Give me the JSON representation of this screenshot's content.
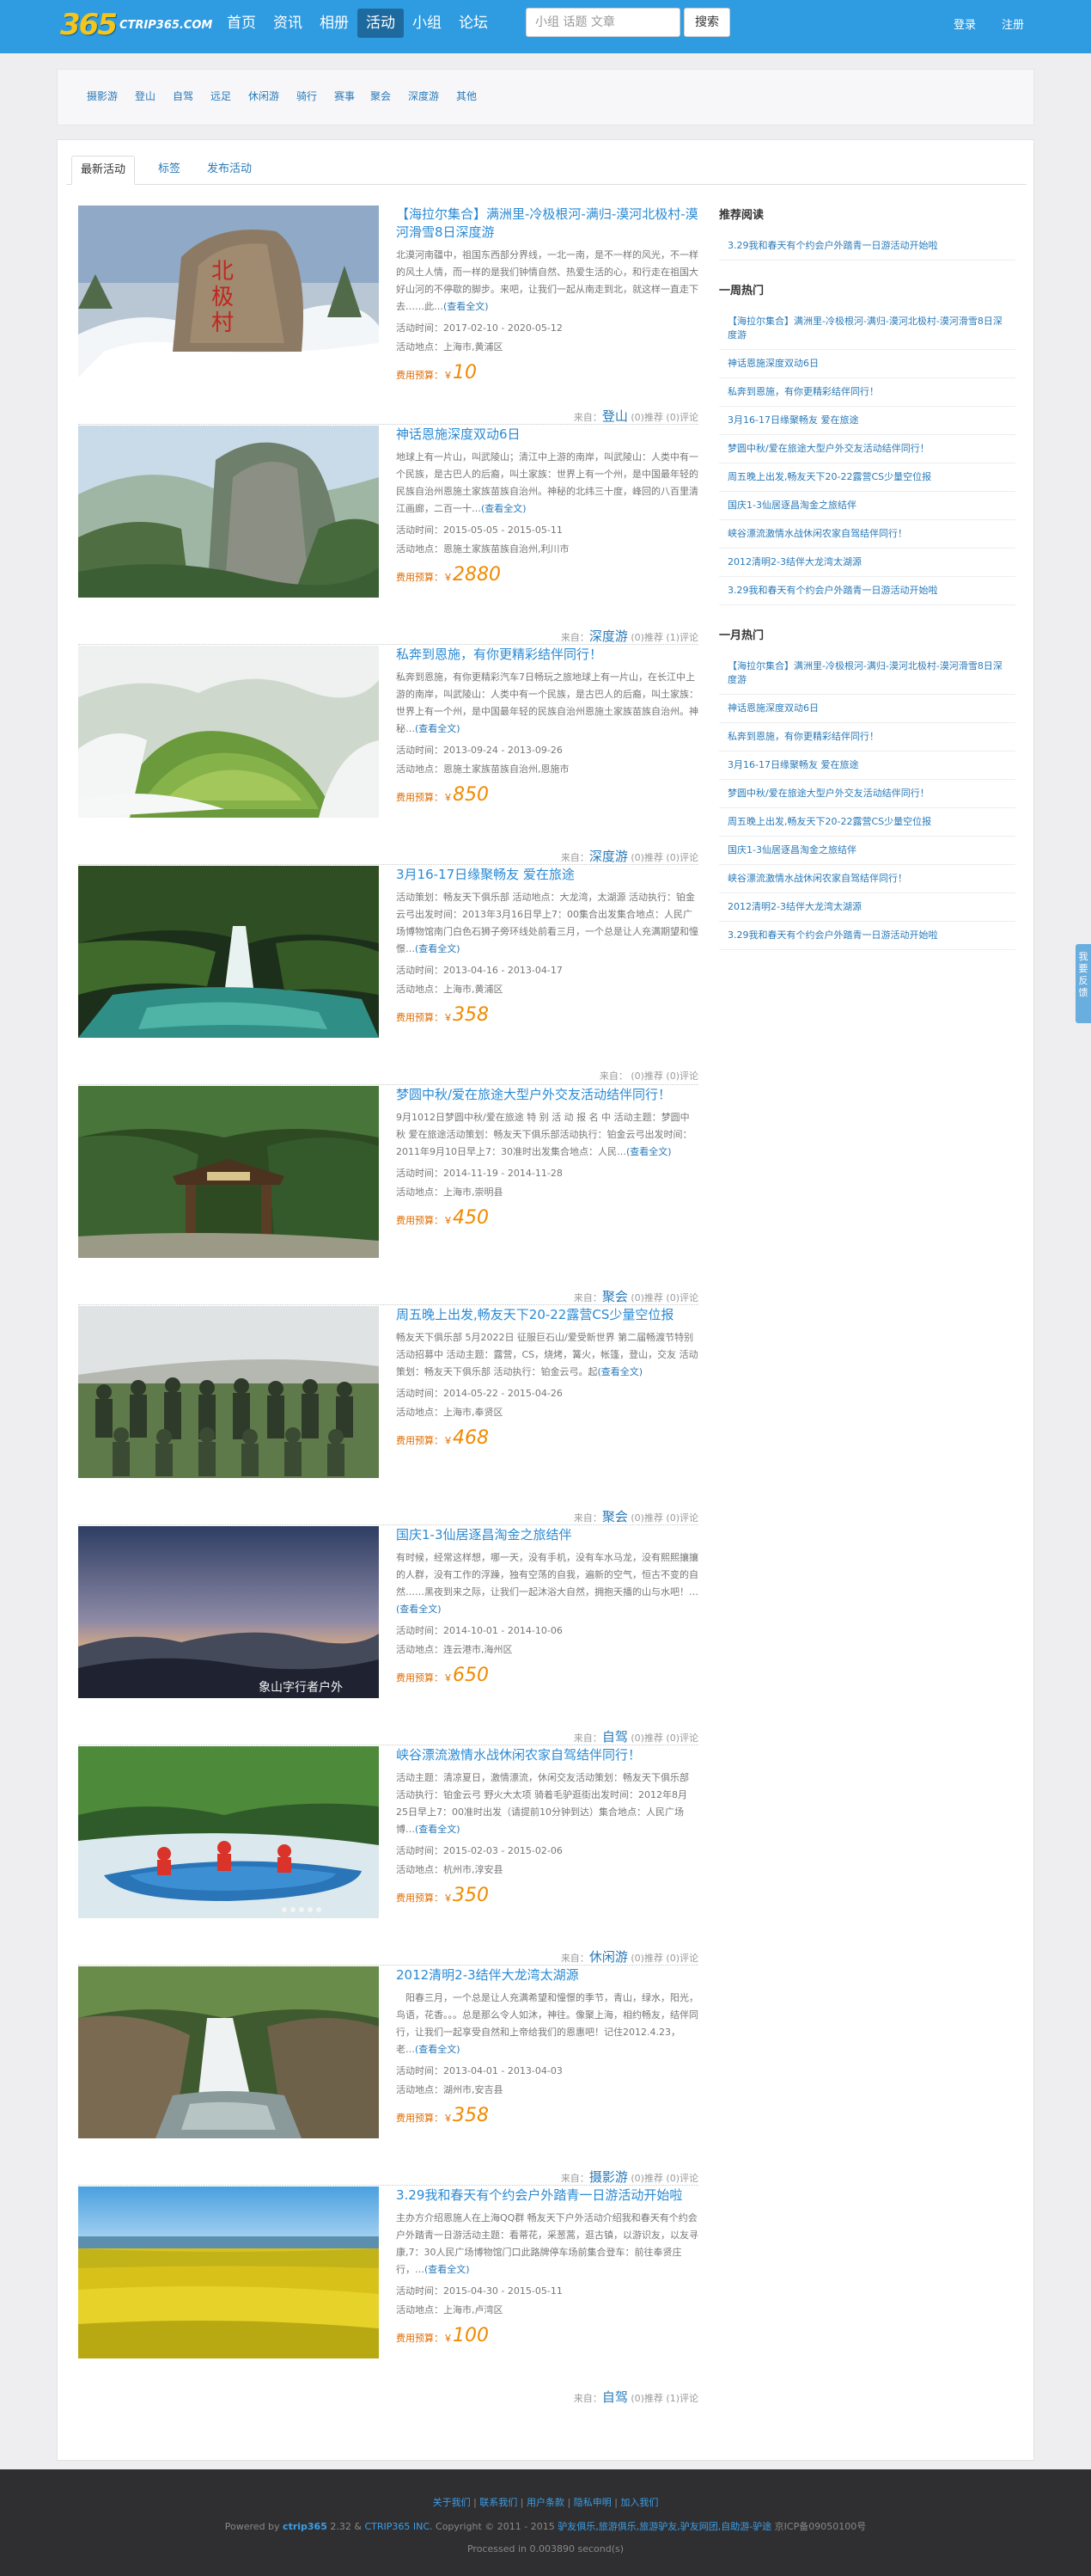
{
  "header": {
    "logo_mark": "365",
    "logo_text": "CTRIP365.COM",
    "nav": [
      "首页",
      "资讯",
      "相册",
      "活动",
      "小组",
      "论坛"
    ],
    "active_nav": "活动",
    "search_placeholder": "小组 话题 文章",
    "search_button": "搜索",
    "login": "登录",
    "register": "注册"
  },
  "categories": [
    "摄影游",
    "登山",
    "自驾",
    "远足",
    "休闲游",
    "骑行",
    "赛事",
    "聚会",
    "深度游",
    "其他"
  ],
  "tabs": [
    "最新活动",
    "标签",
    "发布活动"
  ],
  "activities": [
    {
      "title": "【海拉尔集合】满洲里-冷极根河-满归-漠河北极村-漠河滑雪8日深度游",
      "desc": "北漠河南疆中，祖国东西部分界线，一北一南，是不一样的风光，不一样的风土人情，而一样的是我们钟情自然、热爱生活的心，和行走在祖国大好山河的不停歇的脚步。来吧，让我们一起从南走到北，就这样一直走下去……此…",
      "more": "(查看全文)",
      "time": "活动时间：2017-02-10 - 2020-05-12",
      "place": "活动地点：上海市,黄浦区",
      "budget_label": "费用预算：￥",
      "budget": "10",
      "from": "来自：",
      "source": "登山",
      "stats": "(0)推荐 (0)评论"
    },
    {
      "title": "神话恩施深度双动6日",
      "desc": "地球上有一片山，叫武陵山；清江中上游的南岸，叫武陵山：人类中有一个民族，是古巴人的后裔，叫土家族：世界上有一个州，是中国最年轻的民族自治州恩施土家族苗族自治州。神秘的北纬三十度，峰回的八百里清江画廊，二百一十…",
      "more": "(查看全文)",
      "time": "活动时间：2015-05-05 - 2015-05-11",
      "place": "活动地点：恩施土家族苗族自治州,利川市",
      "budget_label": "费用预算：￥",
      "budget": "2880",
      "from": "来自：",
      "source": "深度游",
      "stats": "(0)推荐 (1)评论"
    },
    {
      "title": "私奔到恩施，有你更精彩结伴同行！",
      "desc": "私奔到恩施，有你更精彩汽车7日畅玩之旅地球上有一片山，在长江中上游的南岸，叫武陵山：人类中有一个民族，是古巴人的后裔，叫土家族：世界上有一个州，是中国最年轻的民族自治州恩施土家族苗族自治州。神秘…",
      "more": "(查看全文)",
      "time": "活动时间：2013-09-24 - 2013-09-26",
      "place": "活动地点：恩施土家族苗族自治州,恩施市",
      "budget_label": "费用预算：￥",
      "budget": "850",
      "from": "来自：",
      "source": "深度游",
      "stats": "(0)推荐 (0)评论"
    },
    {
      "title": "3月16-17日缘聚畅友 爱在旅途",
      "desc": "活动策划：畅友天下俱乐部 活动地点：大龙湾，太湖源 活动执行：铂金云弓出发时间：2013年3月16日早上7：00集合出发集合地点：人民广场博物馆南门白色石狮子旁环线处前看三月，一个总是让人充满期望和憧憬…",
      "more": "(查看全文)",
      "time": "活动时间：2013-04-16 - 2013-04-17",
      "place": "活动地点：上海市,黄浦区",
      "budget_label": "费用预算：￥",
      "budget": "358",
      "from": "来自：",
      "source": "",
      "stats": "(0)推荐 (0)评论"
    },
    {
      "title": "梦圆中秋/爱在旅途大型户外交友活动结伴同行！",
      "desc": "9月1012日梦圆中秋/爱在旅途 特 别 活 动 报 名 中 活动主题：梦圆中秋 爱在旅途活动策划：畅友天下俱乐部活动执行：铂金云弓出发时间：2011年9月10日早上7：30准时出发集合地点：人民…",
      "more": "(查看全文)",
      "time": "活动时间：2014-11-19 - 2014-11-28",
      "place": "活动地点：上海市,崇明县",
      "budget_label": "费用预算：￥",
      "budget": "450",
      "from": "来自：",
      "source": "聚会",
      "stats": "(0)推荐 (0)评论"
    },
    {
      "title": "周五晚上出发,畅友天下20-22露营CS少量空位报",
      "desc": "畅友天下俱乐部 5月2022日 征服巨石山/爱受新世界 第二届畅渡节特别活动招募中 活动主题：露营，CS，烧烤，篝火，帐篷，登山，交友 活动策划：畅友天下俱乐部 活动执行：铂金云弓。起",
      "more": "(查看全文)",
      "time": "活动时间：2014-05-22 - 2015-04-26",
      "place": "活动地点：上海市,奉贤区",
      "budget_label": "费用预算：￥",
      "budget": "468",
      "from": "来自：",
      "source": "聚会",
      "stats": "(0)推荐 (0)评论"
    },
    {
      "title": "国庆1-3仙居逐昌淘金之旅结伴",
      "desc": "有时候，经常这样想，哪一天，没有手机，没有车水马龙，没有熙熙攘攘的人群，没有工作的浮躁，独有空荡的自我，遍新的空气，恒古不变的自然……黑夜到来之际，让我们一起沐浴大自然，拥抱天播的山与水吧！…",
      "more": "(查看全文)",
      "time": "活动时间：2014-10-01 - 2014-10-06",
      "place": "活动地点：连云港市,海州区",
      "budget_label": "费用预算：￥",
      "budget": "650",
      "from": "来自：",
      "source": "自驾",
      "stats": "(0)推荐 (0)评论"
    },
    {
      "title": "峡谷漂流激情水战休闲农家自驾结伴同行！",
      "desc": "活动主题：清凉夏日，激情漂流，休闲交友活动策划：畅友天下俱乐部 活动执行：铂金云弓 野火大太项 骑着毛驴逛街出发时间：2012年8月25日早上7：00准时出发（请提前10分钟到达）集合地点：人民广场博…",
      "more": "(查看全文)",
      "time": "活动时间：2015-02-03 - 2015-02-06",
      "place": "活动地点：杭州市,淳安县",
      "budget_label": "费用预算：￥",
      "budget": "350",
      "from": "来自：",
      "source": "休闲游",
      "stats": "(0)推荐 (0)评论"
    },
    {
      "title": "2012清明2-3结伴大龙湾太湖源",
      "desc": "　阳春三月，一个总是让人充满希望和憧憬的季节，青山，绿水，阳光，鸟语，花香。。。总是那么令人如沐，神往。像聚上海，相约畅友，结伴同行，让我们一起享受自然和上帝给我们的恩惠吧！记住2012.4.23，老…",
      "more": "(查看全文)",
      "time": "活动时间：2013-04-01 - 2013-04-03",
      "place": "活动地点：湖州市,安吉县",
      "budget_label": "费用预算：￥",
      "budget": "358",
      "from": "来自：",
      "source": "摄影游",
      "stats": "(0)推荐 (0)评论"
    },
    {
      "title": "3.29我和春天有个约会户外踏青一日游活动开始啦",
      "desc": "主办方介绍恩施人在上海QQ群 畅友天下户外活动介绍我和春天有个约会户外踏青一日游活动主题：看蒂花，采葱蒿，逛古镇，以游识友，以友寻康,7：30人民广场博物馆门口此路牌停车场前集合登车：前往奉贤庄行，…",
      "more": "(查看全文)",
      "time": "活动时间：2015-04-30 - 2015-05-11",
      "place": "活动地点：上海市,卢湾区",
      "budget_label": "费用预算：￥",
      "budget": "100",
      "from": "来自：",
      "source": "自驾",
      "stats": "(0)推荐 (1)评论"
    }
  ],
  "sidebar": {
    "recommend_title": "推荐阅读",
    "recommend": [
      "3.29我和春天有个约会户外踏青一日游活动开始啦"
    ],
    "week_title": "一周热门",
    "week": [
      "【海拉尔集合】满洲里-冷极根河-满归-漠河北极村-漠河滑雪8日深度游",
      "神话恩施深度双动6日",
      "私奔到恩施，有你更精彩结伴同行！",
      "3月16-17日缘聚畅友 爱在旅途",
      "梦圆中秋/爱在旅途大型户外交友活动结伴同行！",
      "周五晚上出发,畅友天下20-22露营CS少量空位报",
      "国庆1-3仙居逐昌淘金之旅结伴",
      "峡谷漂流激情水战休闲农家自驾结伴同行！",
      "2012清明2-3结伴大龙湾太湖源",
      "3.29我和春天有个约会户外踏青一日游活动开始啦"
    ],
    "month_title": "一月热门",
    "month": [
      "【海拉尔集合】满洲里-冷极根河-满归-漠河北极村-漠河滑雪8日深度游",
      "神话恩施深度双动6日",
      "私奔到恩施，有你更精彩结伴同行！",
      "3月16-17日缘聚畅友 爱在旅途",
      "梦圆中秋/爱在旅途大型户外交友活动结伴同行！",
      "周五晚上出发,畅友天下20-22露营CS少量空位报",
      "国庆1-3仙居逐昌淘金之旅结伴",
      "峡谷漂流激情水战休闲农家自驾结伴同行！",
      "2012清明2-3结伴大龙湾太湖源",
      "3.29我和春天有个约会户外踏青一日游活动开始啦"
    ]
  },
  "float_tab": "我要反馈",
  "footer": {
    "links": [
      "关于我们",
      "联系我们",
      "用户条款",
      "隐私申明",
      "加入我们"
    ],
    "powered": "Powered by",
    "brand": "ctrip365",
    "version": "2.32 &",
    "company": "CTRIP365 INC",
    "copyright": ". Copyright © 2011 - 2015",
    "tags": "驴友俱乐,旅游俱乐,旅游驴友,驴友网团,自助游-驴途",
    "icp": "京ICP备09050100号",
    "processed": "Processed in 0.003890 second(s)"
  },
  "colors": {
    "topbar": "#2f9be0",
    "link": "#2a7ab8",
    "price": "#f08a00",
    "footer": "#2f2f31"
  }
}
